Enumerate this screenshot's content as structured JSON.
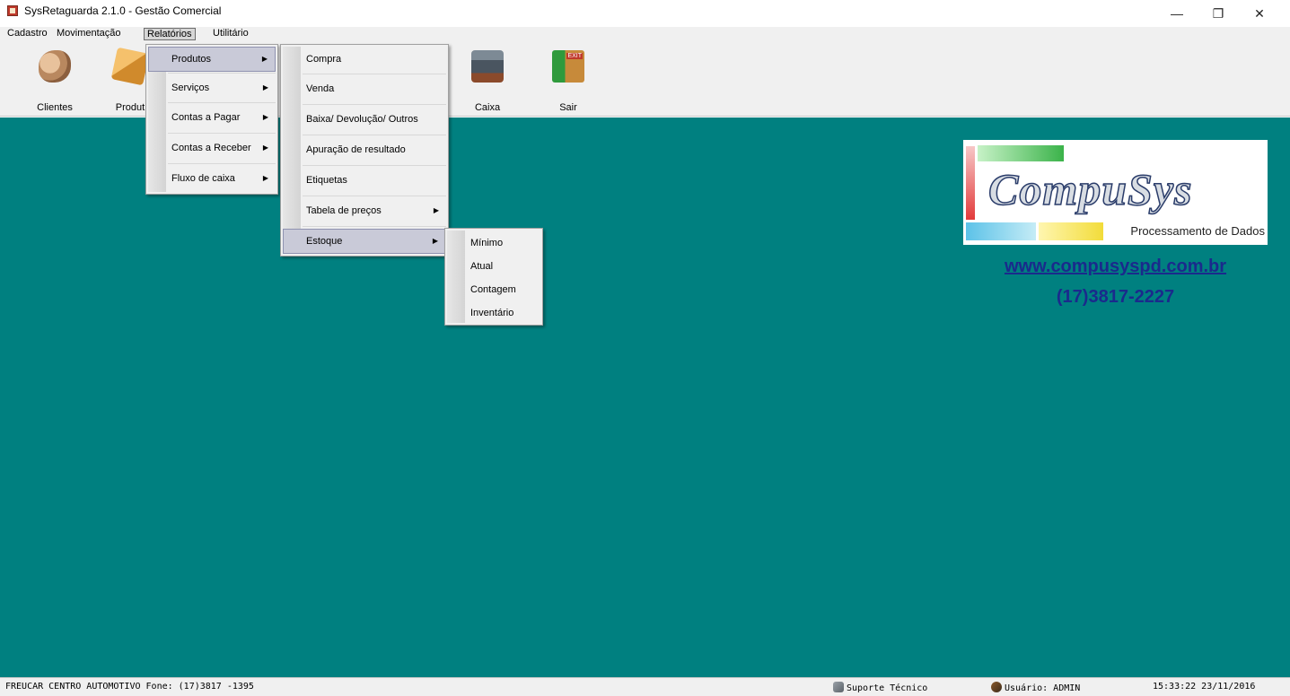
{
  "window": {
    "title": "SysRetaguarda 2.1.0 - Gestão Comercial",
    "controls": {
      "minimize": "—",
      "restore": "❐",
      "close": "✕"
    }
  },
  "menubar": {
    "items": [
      {
        "label": "Cadastro"
      },
      {
        "label": "Movimentação"
      },
      {
        "label": "Relatórios",
        "active": true
      },
      {
        "label": "Utilitário"
      }
    ]
  },
  "toolbar": {
    "buttons": [
      {
        "label": "Clientes",
        "icon": "handshake-icon"
      },
      {
        "label": "Produt",
        "icon": "box-icon"
      },
      {
        "label": "Caixa",
        "icon": "cash-register-icon"
      },
      {
        "label": "Sair",
        "icon": "exit-door-icon"
      }
    ]
  },
  "menus": {
    "relatorios": {
      "items": [
        {
          "label": "Produtos",
          "submenu": true,
          "selected": true
        },
        {
          "label": "Serviços",
          "submenu": true
        },
        {
          "label": "Contas a Pagar",
          "submenu": true
        },
        {
          "label": "Contas a Receber",
          "submenu": true
        },
        {
          "label": "Fluxo de caixa",
          "submenu": true
        }
      ]
    },
    "produtos": {
      "items": [
        {
          "label": "Compra"
        },
        {
          "label": "Venda"
        },
        {
          "label": "Baixa/ Devolução/ Outros"
        },
        {
          "label": "Apuração de resultado"
        },
        {
          "label": "Etiquetas"
        },
        {
          "label": "Tabela de preços",
          "submenu": true
        },
        {
          "label": "Estoque",
          "submenu": true,
          "selected": true
        }
      ]
    },
    "estoque": {
      "items": [
        {
          "label": "Mínimo"
        },
        {
          "label": "Atual"
        },
        {
          "label": "Contagem"
        },
        {
          "label": "Inventário"
        }
      ]
    }
  },
  "logo": {
    "name": "CompuSys",
    "tagline": "Processamento de Dados",
    "url": "www.compusyspd.com.br",
    "phone": "(17)3817-2227"
  },
  "statusbar": {
    "company": "FREUCAR CENTRO AUTOMOTIVO Fone: (17)3817 -1395",
    "support": "Suporte Técnico",
    "user": "Usuário: ADMIN",
    "clock": "15:33:22 23/11/2016"
  },
  "colors": {
    "workspace": "#008080",
    "logo_text": "#1a2a8c",
    "menu_selected": "#c9cad8"
  }
}
